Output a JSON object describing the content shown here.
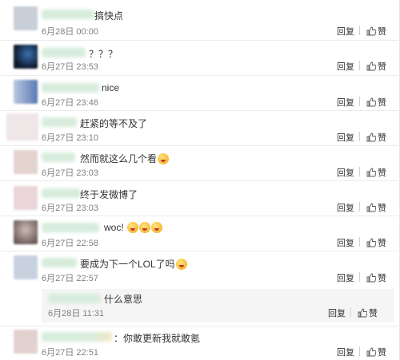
{
  "actions": {
    "reply": "回复",
    "like": "赞"
  },
  "comments": [
    {
      "text": "搞快点",
      "time": "6月28日 00:00"
    },
    {
      "text": "？？？",
      "time": "6月27日 23:53"
    },
    {
      "text": "nice",
      "time": "6月27日 23:46"
    },
    {
      "text": "赶紧的等不及了",
      "time": "6月27日 23:10"
    },
    {
      "text": "然而就这么几个看",
      "time": "6月27日 23:03"
    },
    {
      "text": "终于发微博了",
      "time": "6月27日 23:03"
    },
    {
      "text": "woc!",
      "time": "6月27日 22:58"
    },
    {
      "text": "要成为下一个LOL了吗",
      "time": "6月27日 22:57"
    },
    {
      "text": "：你敢更新我就敢氪",
      "time": "6月27日 22:51"
    }
  ],
  "sub_reply": {
    "text": "什么意思",
    "time": "6月28日 11:31"
  },
  "colors": {
    "separator": "#ececec",
    "sub_bg": "#f5f5f5",
    "time": "#808080"
  },
  "icons": {
    "like": "thumbs-up-icon"
  }
}
